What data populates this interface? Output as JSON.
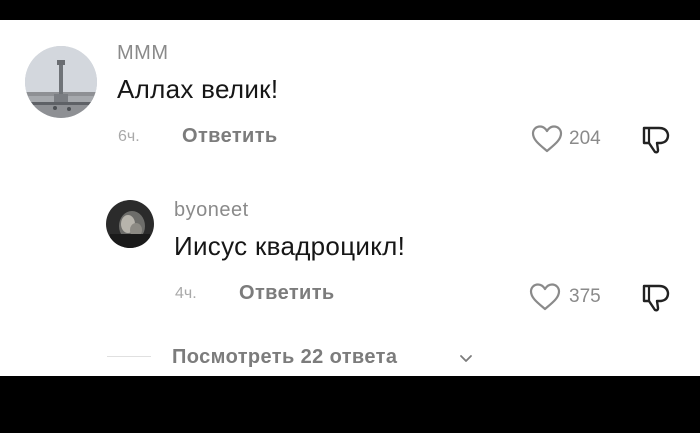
{
  "comments": [
    {
      "username": "МММ",
      "text": "Аллах велик!",
      "time": "6ч.",
      "reply_label": "Ответить",
      "likes": "204",
      "avatar_icon": "monument-photo-avatar",
      "like_icon": "heart-icon",
      "dislike_icon": "thumbs-down-icon"
    },
    {
      "username": "byoneet",
      "text": "Иисус квадроцикл!",
      "time": "4ч.",
      "reply_label": "Ответить",
      "likes": "375",
      "avatar_icon": "dark-photo-avatar",
      "like_icon": "heart-icon",
      "dislike_icon": "thumbs-down-icon"
    }
  ],
  "view_replies_label": "Посмотреть 22 ответа",
  "colors": {
    "background": "#ffffff",
    "frame": "#000000",
    "text": "#161616",
    "secondary": "#8a8a8a"
  }
}
